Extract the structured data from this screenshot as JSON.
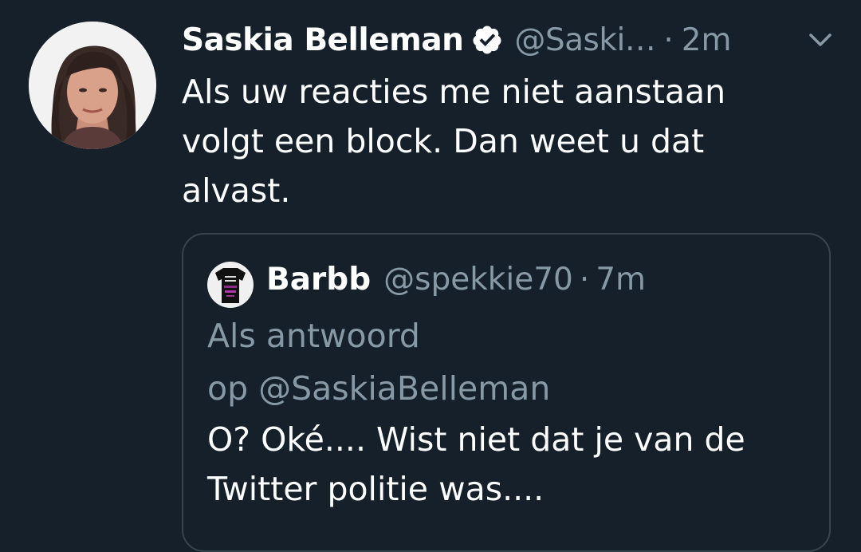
{
  "tweet": {
    "author": {
      "display_name": "Saskia Belleman",
      "verified": true,
      "handle": "@Saski…",
      "avatar_icon": "profile-photo"
    },
    "separator": "·",
    "time": "2m",
    "menu_icon": "chevron-down-icon",
    "text_lines": [
      "Als uw reacties me niet aanstaan",
      "volgt een block. Dan weet u dat",
      "alvast."
    ]
  },
  "quoted_tweet": {
    "author": {
      "display_name": "Barbb",
      "handle": "@spekkie70",
      "avatar_icon": "profile-photo"
    },
    "separator": "·",
    "time": "7m",
    "replying_lines": [
      "Als antwoord",
      "op @SaskiaBelleman"
    ],
    "text_lines": [
      "O? Oké.... Wist niet dat je van de",
      "Twitter politie was...."
    ]
  },
  "colors": {
    "background": "#15202b",
    "text_primary": "#ffffff",
    "text_secondary": "#8899a6",
    "border": "#38444d"
  }
}
